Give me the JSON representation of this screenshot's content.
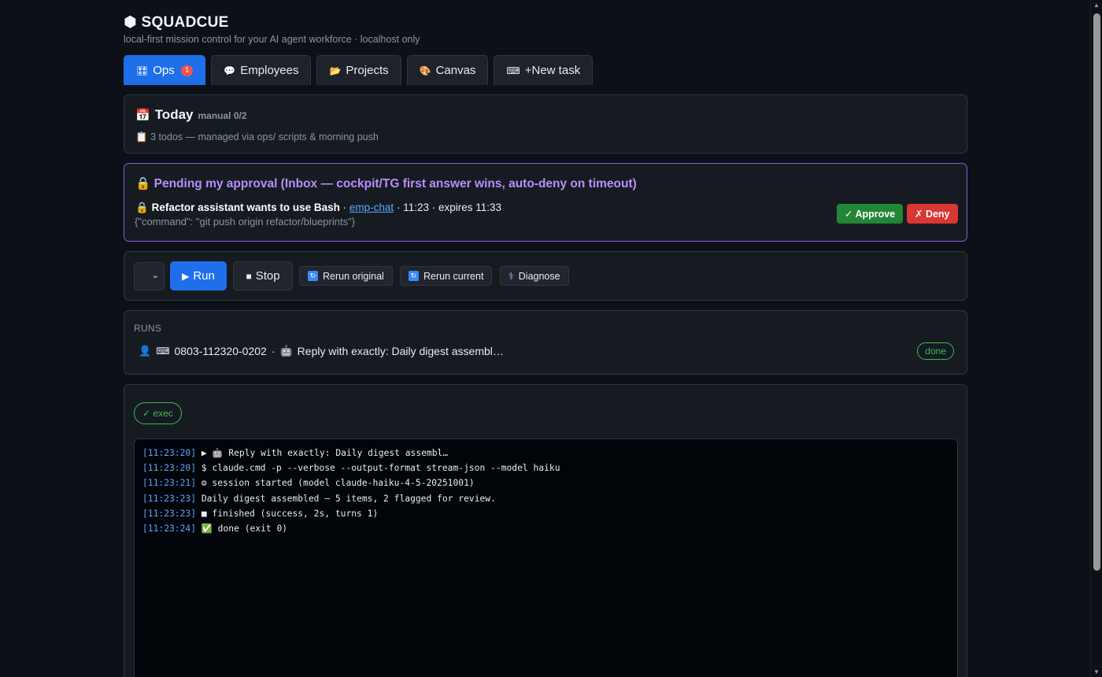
{
  "brand": {
    "icon": "⬢",
    "name": "SQUADCUE",
    "subtitle": "local-first mission control for your AI agent workforce · localhost only"
  },
  "tabs": [
    {
      "icon": "🎛",
      "label": "Ops",
      "badge": "1"
    },
    {
      "icon": "💬",
      "label": "Employees"
    },
    {
      "icon": "📂",
      "label": "Projects"
    },
    {
      "icon": "🎨",
      "label": "Canvas"
    },
    {
      "icon": "⌨",
      "label": "+New task"
    }
  ],
  "today": {
    "icon": "📅",
    "title": "Today",
    "meta": "manual 0/2",
    "note_icon": "📋",
    "note": "3 todos — managed via ops/ scripts & morning push"
  },
  "approval": {
    "heading_icon": "🔒",
    "heading": "Pending my approval (Inbox — cockpit/TG first answer wins, auto-deny on timeout)",
    "item_icon": "🔒",
    "request": "Refactor assistant wants to use Bash",
    "sep1": " · ",
    "source": "emp-chat",
    "time_info": " · 11:23 · expires 11:33",
    "payload": "{\"command\": \"git push origin refactor/blueprints\"}",
    "approve_label": "✓ Approve",
    "deny_label": "✗ Deny"
  },
  "controls": {
    "select_caret": "⌄",
    "run_label": "Run",
    "run_icon": "▶",
    "stop_label": "Stop",
    "stop_icon": "■",
    "rerun_original_label": "Rerun original",
    "rerun_current_label": "Rerun current",
    "diagnose_label": "Diagnose",
    "diagnose_icon": "⚕"
  },
  "runs": {
    "label": "RUNS",
    "items": [
      {
        "user_icon": "👤",
        "kbd_icon": "⌨",
        "id": "0803-112320-0202",
        "sep": " · ",
        "agent_icon": "🤖",
        "text": "Reply with exactly: Daily digest assembl…",
        "status": "done"
      }
    ]
  },
  "log": {
    "pill": "✓ exec",
    "lines": [
      {
        "ts": "[11:23:20]",
        "text": " ▶ 🤖 Reply with exactly: Daily digest assembl…"
      },
      {
        "ts": "[11:23:20]",
        "text": " $ claude.cmd -p --verbose --output-format stream-json --model haiku"
      },
      {
        "ts": "[11:23:21]",
        "text": " ⚙ session started (model claude-haiku-4-5-20251001)"
      },
      {
        "ts": "[11:23:23]",
        "text": " Daily digest assembled — 5 items, 2 flagged for review."
      },
      {
        "ts": "[11:23:23]",
        "text": " ■ finished (success, 2s, turns 1)"
      },
      {
        "ts": "[11:23:24]",
        "text": " ✅ done (exit 0)"
      }
    ]
  },
  "colors": {
    "accent": "#1f6feb",
    "approve": "#238636",
    "deny": "#da3633",
    "purple": "#bc8cff",
    "success": "#3fb950"
  }
}
